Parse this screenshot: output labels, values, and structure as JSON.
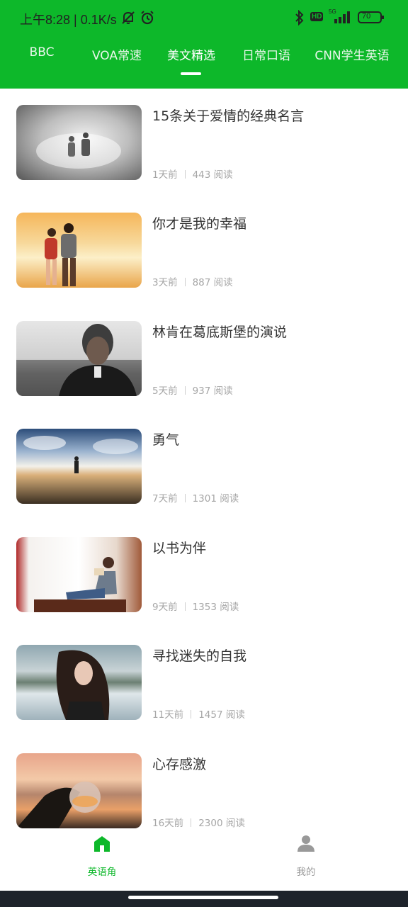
{
  "status": {
    "time": "上午8:28 | 0.1K/s",
    "battery": "70",
    "network": "5G",
    "hd": "HD"
  },
  "tabs": [
    {
      "label": "BBC"
    },
    {
      "label": "VOA常速"
    },
    {
      "label": "美文精选",
      "active": true
    },
    {
      "label": "日常口语"
    },
    {
      "label": "CNN学生英语"
    }
  ],
  "articles": [
    {
      "title": "15条关于爱情的经典名言",
      "time": "1天前",
      "reads": "443 阅读",
      "image": "elderly-couple-walking-photo"
    },
    {
      "title": "你才是我的幸福",
      "time": "3天前",
      "reads": "887 阅读",
      "image": "couple-sunset-photo"
    },
    {
      "title": "林肯在葛底斯堡的演说",
      "time": "5天前",
      "reads": "937 阅读",
      "image": "lincoln-portrait-photo"
    },
    {
      "title": "勇气",
      "time": "7天前",
      "reads": "1301 阅读",
      "image": "person-under-clouds-photo"
    },
    {
      "title": "以书为伴",
      "time": "9天前",
      "reads": "1353 阅读",
      "image": "woman-reading-window-photo"
    },
    {
      "title": "寻找迷失的自我",
      "time": "11天前",
      "reads": "1457 阅读",
      "image": "woman-windblown-hair-photo"
    },
    {
      "title": "心存感激",
      "time": "16天前",
      "reads": "2300 阅读",
      "image": "crystal-ball-sunset-photo"
    }
  ],
  "bottom_nav": {
    "home": {
      "label": "英语角",
      "icon": "home-icon",
      "active": true
    },
    "mine": {
      "label": "我的",
      "icon": "user-icon"
    }
  },
  "colors": {
    "accent": "#0db82a",
    "text": "#333333",
    "meta": "#a6a6a6",
    "inactive": "#999999"
  }
}
